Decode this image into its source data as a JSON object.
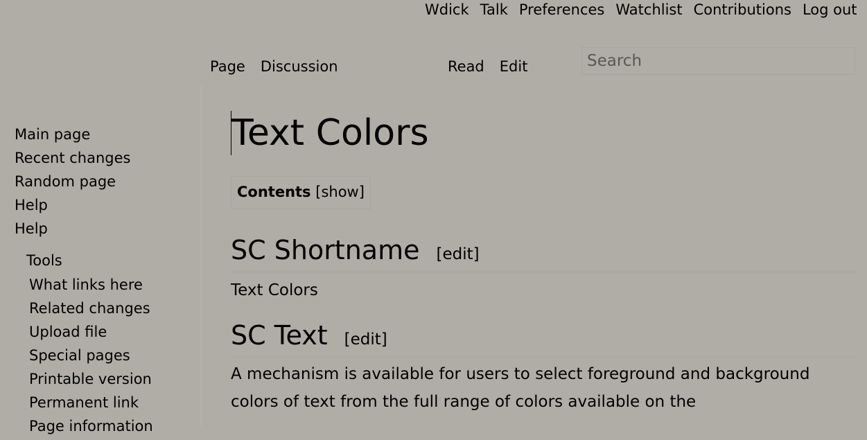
{
  "personal_tools": [
    "Wdick",
    "Talk",
    "Preferences",
    "Watchlist",
    "Contributions",
    "Log out"
  ],
  "namespace_tabs": [
    "Page",
    "Discussion"
  ],
  "view_tabs": [
    "Read",
    "Edit"
  ],
  "search": {
    "placeholder": "Search"
  },
  "sidebar": {
    "navigation": [
      "Main page",
      "Recent changes",
      "Random page",
      "Help",
      "Help"
    ],
    "tools_heading": "Tools",
    "tools": [
      "What links here",
      "Related changes",
      "Upload file",
      "Special pages",
      "Printable version",
      "Permanent link",
      "Page information"
    ]
  },
  "content": {
    "title": "Text Colors",
    "toc": {
      "label": "Contents",
      "toggle": "[show]"
    },
    "sections": [
      {
        "heading": "SC Shortname",
        "edit": "[edit]",
        "text": "Text Colors"
      },
      {
        "heading": "SC Text",
        "edit": "[edit]",
        "text": "A mechanism is available for users to select foreground and background colors of text from the full range of colors available on the"
      }
    ]
  }
}
